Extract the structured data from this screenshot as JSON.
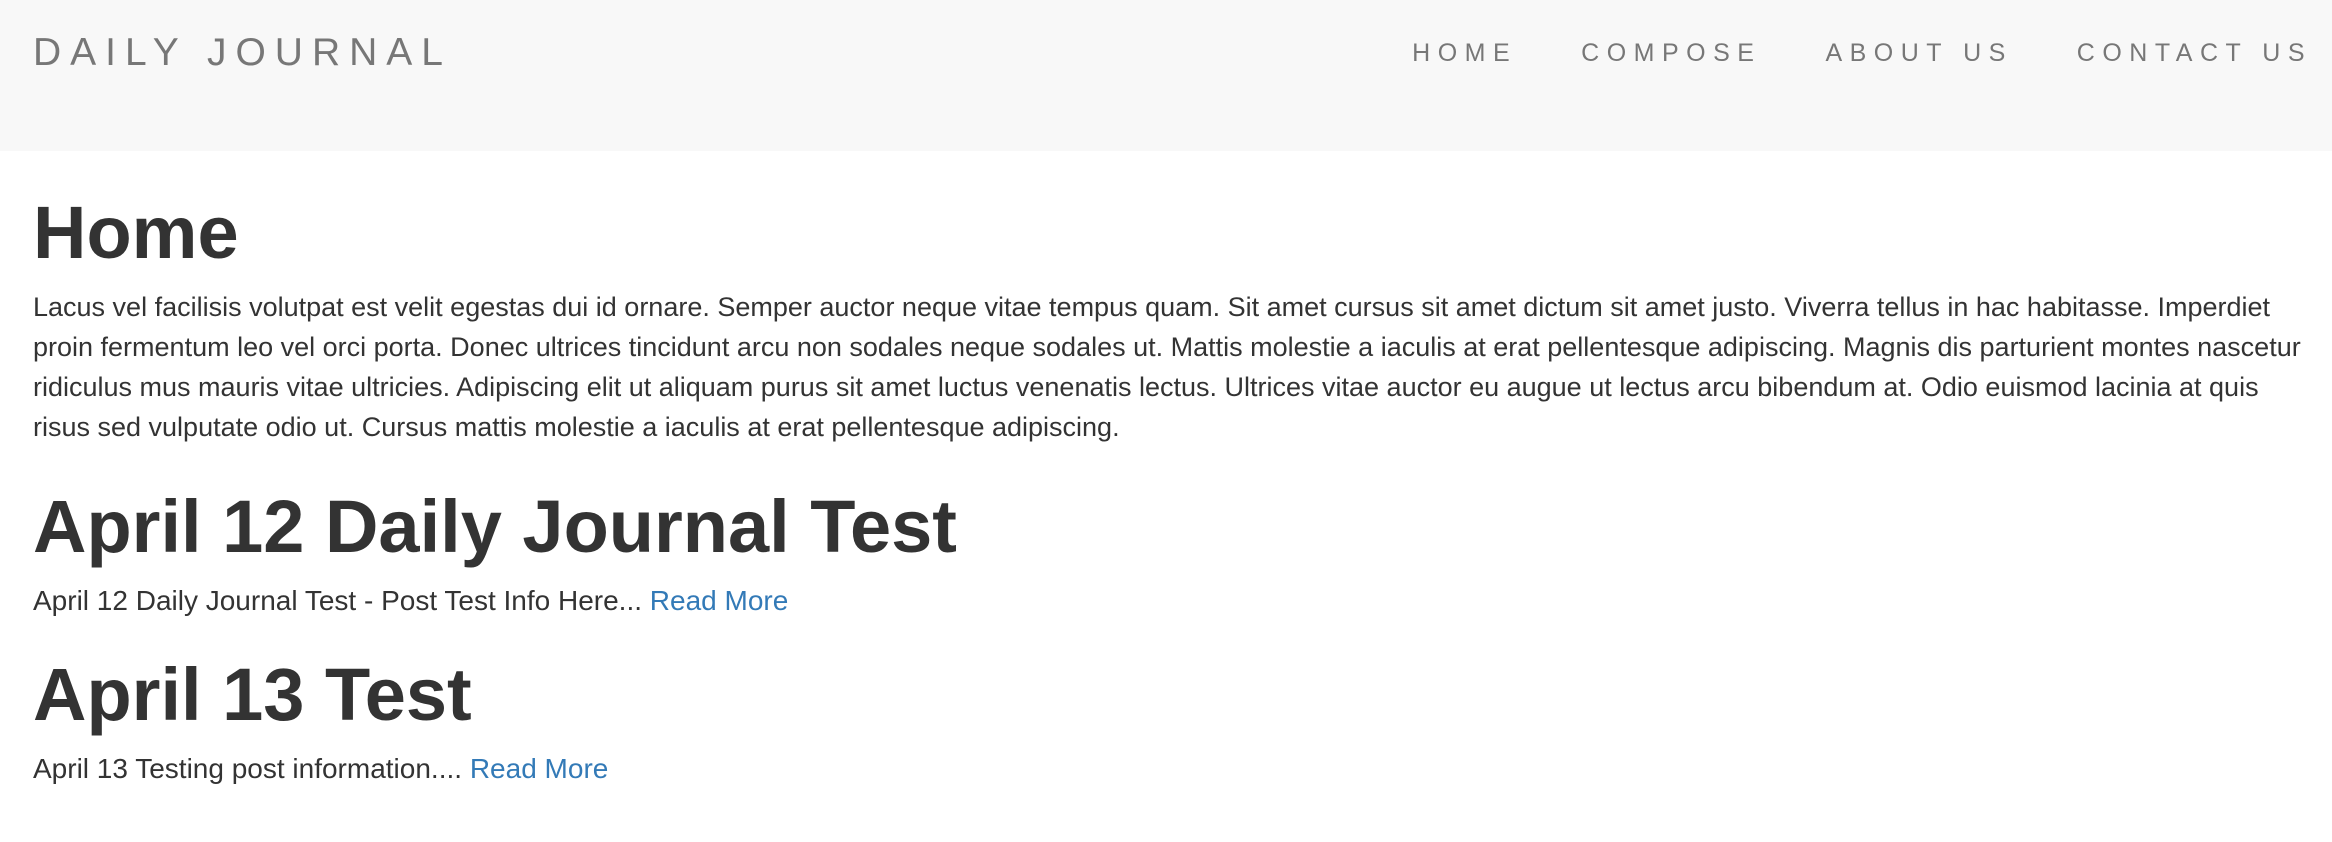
{
  "header": {
    "brand": "DAILY JOURNAL",
    "nav": [
      {
        "label": "HOME"
      },
      {
        "label": "COMPOSE"
      },
      {
        "label": "ABOUT US"
      },
      {
        "label": "CONTACT US"
      }
    ]
  },
  "main": {
    "title": "Home",
    "intro": "Lacus vel facilisis volutpat est velit egestas dui id ornare. Semper auctor neque vitae tempus quam. Sit amet cursus sit amet dictum sit amet justo. Viverra tellus in hac habitasse. Imperdiet proin fermentum leo vel orci porta. Donec ultrices tincidunt arcu non sodales neque sodales ut. Mattis molestie a iaculis at erat pellentesque adipiscing. Magnis dis parturient montes nascetur ridiculus mus mauris vitae ultricies. Adipiscing elit ut aliquam purus sit amet luctus venenatis lectus. Ultrices vitae auctor eu augue ut lectus arcu bibendum at. Odio euismod lacinia at quis risus sed vulputate odio ut. Cursus mattis molestie a iaculis at erat pellentesque adipiscing.",
    "posts": [
      {
        "title": "April 12 Daily Journal Test",
        "excerpt": "April 12 Daily Journal Test - Post Test Info Here...",
        "read_more": "Read More"
      },
      {
        "title": "April 13 Test",
        "excerpt": "April 13 Testing post information....",
        "read_more": "Read More"
      }
    ]
  },
  "colors": {
    "navbar_bg": "#f8f8f8",
    "nav_text": "#777777",
    "body_text": "#333333",
    "link": "#337ab7"
  }
}
